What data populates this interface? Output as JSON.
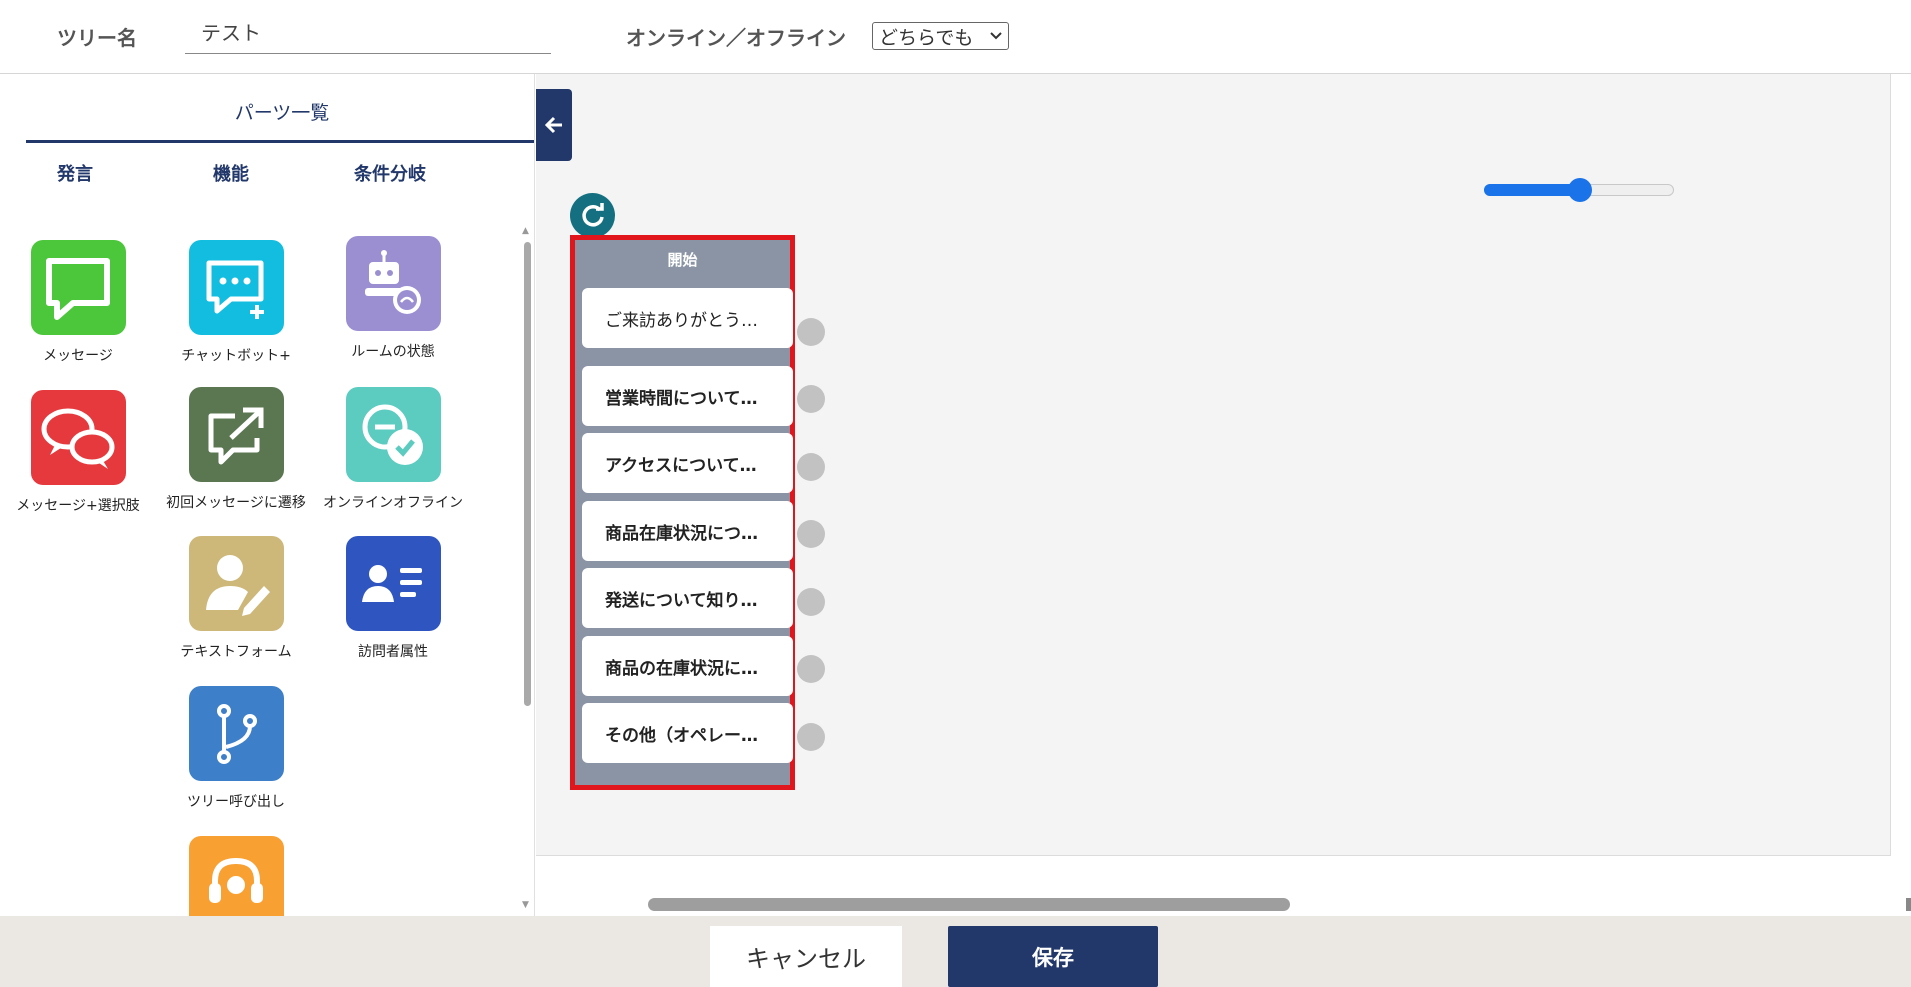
{
  "header": {
    "tree_name_label": "ツリー名",
    "tree_name_value": "テスト",
    "online_label": "オンライン／オフライン",
    "online_select_value": "どちらでも"
  },
  "parts_panel": {
    "title": "パーツ一覧",
    "categories": [
      "発言",
      "機能",
      "条件分岐"
    ],
    "items": [
      {
        "label": "メッセージ",
        "icon": "message-icon",
        "color": "#4cc63a"
      },
      {
        "label": "チャットボット+",
        "icon": "chatbot-plus-icon",
        "color": "#13bde0"
      },
      {
        "label": "ルームの状態",
        "icon": "room-status-icon",
        "color": "#9b8fd2"
      },
      {
        "label": "メッセージ+選択肢",
        "icon": "message-choices-icon",
        "color": "#e6393e"
      },
      {
        "label": "初回メッセージに遷移",
        "icon": "jump-first-message-icon",
        "color": "#5b7752"
      },
      {
        "label": "オンラインオフライン",
        "icon": "online-offline-icon",
        "color": "#5ccbc0"
      },
      {
        "label": "テキストフォーム",
        "icon": "text-form-icon",
        "color": "#cdb779"
      },
      {
        "label": "訪問者属性",
        "icon": "visitor-attribute-icon",
        "color": "#2f56c0"
      },
      {
        "label": "ツリー呼び出し",
        "icon": "tree-call-icon",
        "color": "#3d7fc8"
      },
      {
        "label": "",
        "icon": "operator-headset-icon",
        "color": "#f8a031"
      }
    ]
  },
  "canvas": {
    "zoom_level": 0.5,
    "start_node": {
      "title": "開始",
      "items": [
        "ご来訪ありがとう…",
        "営業時間について…",
        "アクセスについて…",
        "商品在庫状況につ…",
        "発送について知り…",
        "商品の在庫状況に…",
        "その他（オペレー…"
      ]
    },
    "colors": {
      "accent": "#22386b",
      "highlight_border": "#e0161c",
      "node_bg": "#8a94a4"
    }
  },
  "footer": {
    "cancel_label": "キャンセル",
    "save_label": "保存"
  }
}
